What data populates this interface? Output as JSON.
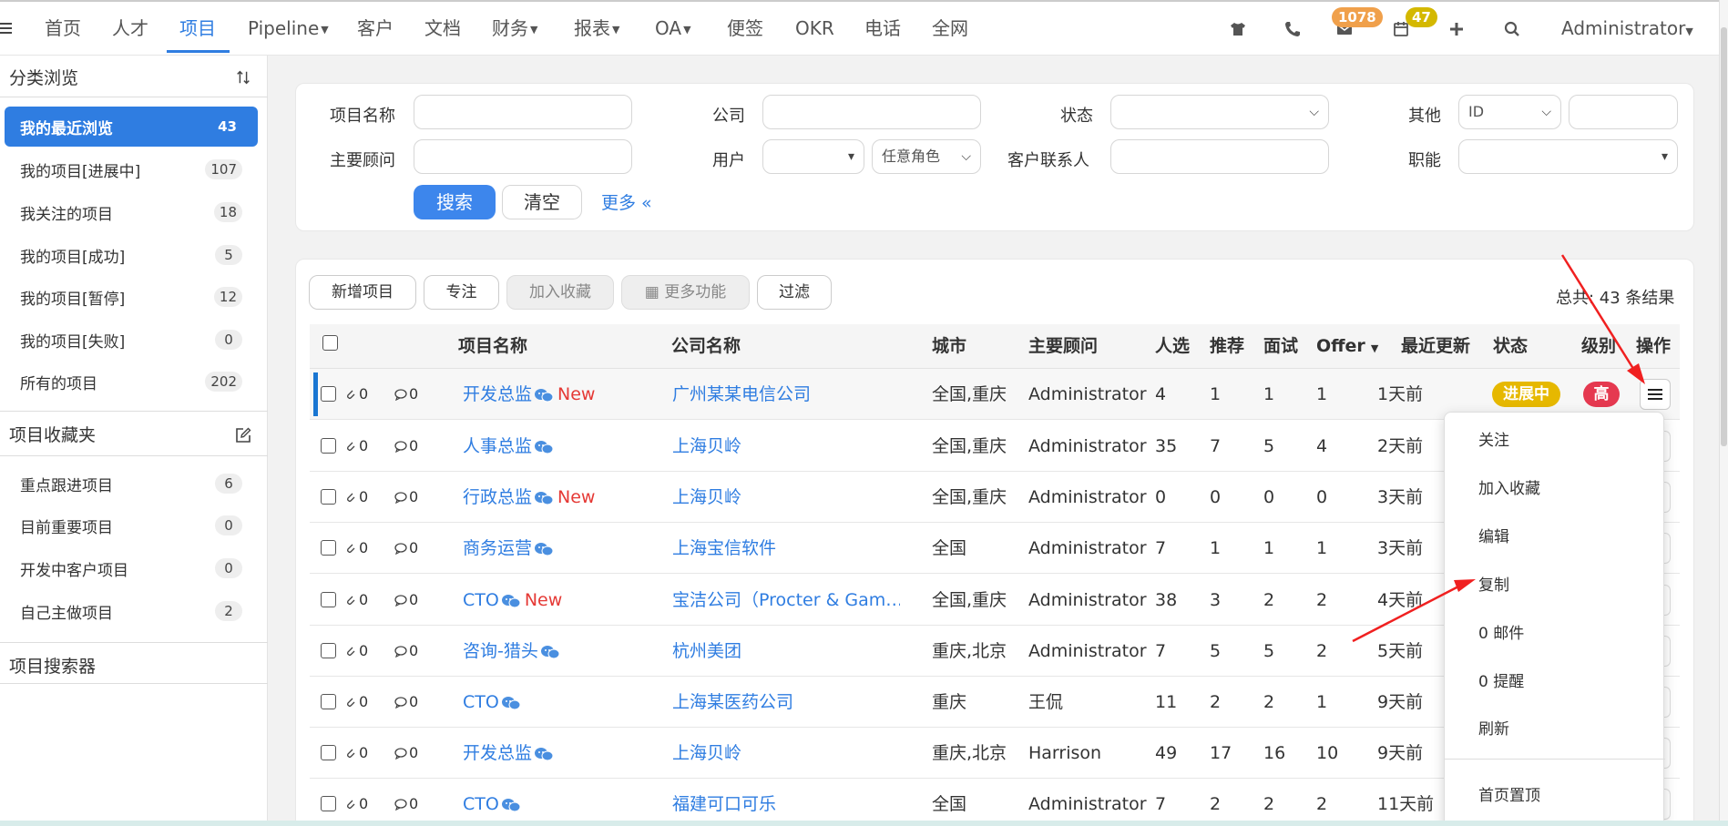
{
  "nav": {
    "items": [
      "首页",
      "人才",
      "项目",
      "Pipeline",
      "客户",
      "文档",
      "财务",
      "报表",
      "OA",
      "便签",
      "OKR",
      "电话",
      "全网"
    ],
    "active_index": 2,
    "mail_badge": "1078",
    "calendar_badge": "47",
    "user": "Administrator",
    "accent": "#2f7de1"
  },
  "sidebar": {
    "browse_title": "分类浏览",
    "browse_items": [
      {
        "label": "我的最近浏览",
        "count": "43"
      },
      {
        "label": "我的项目[进展中]",
        "count": "107"
      },
      {
        "label": "我关注的项目",
        "count": "18"
      },
      {
        "label": "我的项目[成功]",
        "count": "5"
      },
      {
        "label": "我的项目[暂停]",
        "count": "12"
      },
      {
        "label": "我的项目[失败]",
        "count": "0"
      },
      {
        "label": "所有的项目",
        "count": "202"
      }
    ],
    "fav_title": "项目收藏夹",
    "fav_items": [
      {
        "label": "重点跟进项目",
        "count": "6"
      },
      {
        "label": "目前重要项目",
        "count": "0"
      },
      {
        "label": "开发中客户项目",
        "count": "0"
      },
      {
        "label": "自己主做项目",
        "count": "2"
      }
    ],
    "searcher_title": "项目搜索器"
  },
  "search": {
    "project_name": "项目名称",
    "company": "公司",
    "status": "状态",
    "other": "其他",
    "other_value": "ID",
    "consultant": "主要顾问",
    "user": "用户",
    "role_value": "任意角色",
    "contact": "客户联系人",
    "function": "职能",
    "search_btn": "搜索",
    "clear_btn": "清空",
    "more": "更多 «"
  },
  "toolbar": {
    "add": "新增项目",
    "focus": "专注",
    "add_fav": "加入收藏",
    "more_func": "更多功能",
    "filter": "过滤",
    "total": "总共: 43 条结果"
  },
  "table": {
    "headers": [
      "项目名称",
      "公司名称",
      "城市",
      "主要顾问",
      "人选",
      "推荐",
      "面试",
      "Offer",
      "最近更新",
      "状态",
      "级别",
      "操作"
    ],
    "rows": [
      {
        "attach": "0",
        "comment": "0",
        "name": "开发总监",
        "new": "New",
        "company": "广州某某电信公司",
        "city": "全国,重庆",
        "consultant": "Administrator",
        "candidates": "4",
        "recommend": "1",
        "interview": "1",
        "offer": "1",
        "updated": "1天前",
        "status": "进展中",
        "level": "高"
      },
      {
        "attach": "0",
        "comment": "0",
        "name": "人事总监",
        "new": "",
        "company": "上海贝岭",
        "city": "全国,重庆",
        "consultant": "Administrator",
        "candidates": "35",
        "recommend": "7",
        "interview": "5",
        "offer": "4",
        "updated": "2天前"
      },
      {
        "attach": "0",
        "comment": "0",
        "name": "行政总监",
        "new": "New",
        "company": "上海贝岭",
        "city": "全国,重庆",
        "consultant": "Administrator",
        "candidates": "0",
        "recommend": "0",
        "interview": "0",
        "offer": "0",
        "updated": "3天前"
      },
      {
        "attach": "0",
        "comment": "0",
        "name": "商务运营",
        "new": "",
        "company": "上海宝信软件",
        "city": "全国",
        "consultant": "Administrator",
        "candidates": "7",
        "recommend": "1",
        "interview": "1",
        "offer": "1",
        "updated": "3天前"
      },
      {
        "attach": "0",
        "comment": "0",
        "name": "CTO",
        "new": "New",
        "company": "宝洁公司（Procter & Gam…",
        "city": "全国,重庆",
        "consultant": "Administrator",
        "candidates": "38",
        "recommend": "3",
        "interview": "2",
        "offer": "2",
        "updated": "4天前"
      },
      {
        "attach": "0",
        "comment": "0",
        "name": "咨询-猎头",
        "new": "",
        "company": "杭州美团",
        "city": "重庆,北京",
        "consultant": "Administrator",
        "candidates": "7",
        "recommend": "5",
        "interview": "5",
        "offer": "2",
        "updated": "5天前"
      },
      {
        "attach": "0",
        "comment": "0",
        "name": "CTO",
        "new": "",
        "company": "上海某医药公司",
        "city": "重庆",
        "consultant": "王侃",
        "candidates": "11",
        "recommend": "2",
        "interview": "2",
        "offer": "1",
        "updated": "9天前"
      },
      {
        "attach": "0",
        "comment": "0",
        "name": "开发总监",
        "new": "",
        "company": "上海贝岭",
        "city": "重庆,北京",
        "consultant": "Harrison",
        "candidates": "49",
        "recommend": "17",
        "interview": "16",
        "offer": "10",
        "updated": "9天前"
      },
      {
        "attach": "0",
        "comment": "0",
        "name": "CTO",
        "new": "",
        "company": "福建可口可乐",
        "city": "全国",
        "consultant": "Administrator",
        "candidates": "7",
        "recommend": "2",
        "interview": "2",
        "offer": "2",
        "updated": "11天前"
      }
    ],
    "status_color": "#e6b800",
    "level_color": "#e53950"
  },
  "menu": {
    "items": [
      "关注",
      "加入收藏",
      "编辑",
      "复制",
      "0 邮件",
      "0 提醒",
      "刷新"
    ],
    "bottom_item": "首页置顶"
  }
}
